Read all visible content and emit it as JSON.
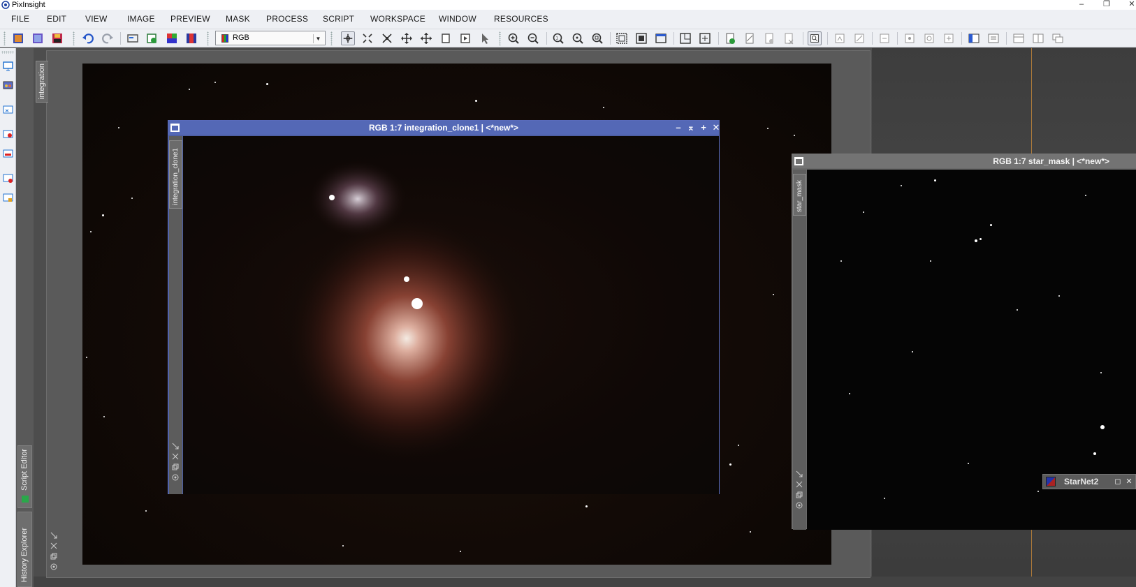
{
  "window": {
    "app_title": "PixInsight",
    "minimize": "–",
    "restore": "❐",
    "close": "✕"
  },
  "menu": {
    "items": [
      "FILE",
      "EDIT",
      "VIEW",
      "IMAGE",
      "PREVIEW",
      "MASK",
      "PROCESS",
      "SCRIPT",
      "WORKSPACE",
      "WINDOW",
      "RESOURCES"
    ]
  },
  "toolbar": {
    "color_mode": "RGB",
    "dropdown_arrow": "▼"
  },
  "explorer_tabs": {
    "script_editor": "Script Editor",
    "history_explorer": "History Explorer"
  },
  "views": {
    "integration": {
      "id": "integration"
    },
    "clone": {
      "id": "integration_clone1",
      "title": "RGB 1:7 integration_clone1 | <*new*>",
      "ctrl_min": "–",
      "ctrl_shade": "⌅",
      "ctrl_max": "+",
      "ctrl_close": "✕"
    },
    "star_mask": {
      "id": "star_mask",
      "title": "RGB 1:7 star_mask | <*new*>"
    }
  },
  "process_icon": {
    "label": "StarNet2",
    "restore": "◻",
    "close": "✕"
  },
  "colors": {
    "active_title": "#5468b6",
    "inactive_title": "#737373",
    "menu_bg": "#eef0f4",
    "workspace_bg": "#4d4d4d"
  }
}
